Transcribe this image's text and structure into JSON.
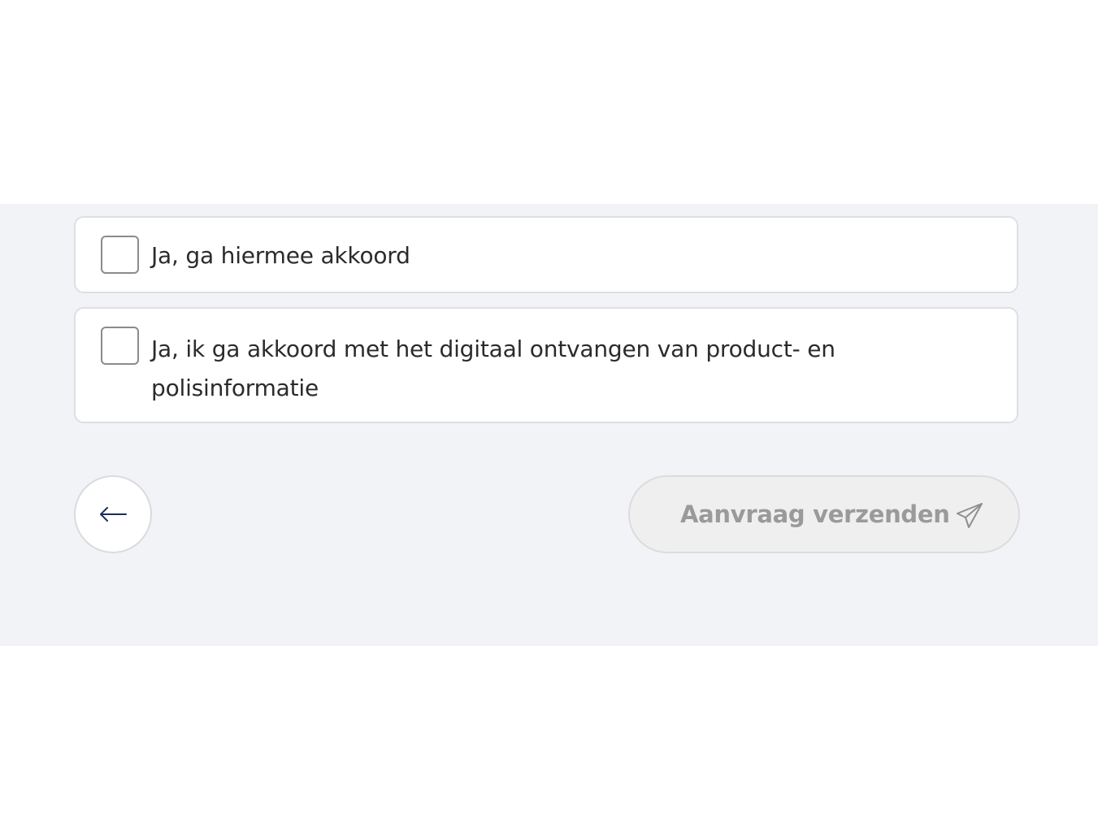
{
  "consent": {
    "options": [
      {
        "label": "Ja, ga hiermee akkoord",
        "checked": false
      },
      {
        "label": "Ja, ik ga akkoord met het digitaal ontvangen van product- en polisinformatie",
        "checked": false
      }
    ]
  },
  "navigation": {
    "back_icon": "arrow-left-icon",
    "submit_label": "Aanvraag verzenden",
    "submit_icon": "send-icon",
    "submit_enabled": false
  },
  "colors": {
    "panel_background": "#f2f3f6",
    "arrow": "#1b2d5c",
    "disabled_text": "#9a9a9a"
  }
}
